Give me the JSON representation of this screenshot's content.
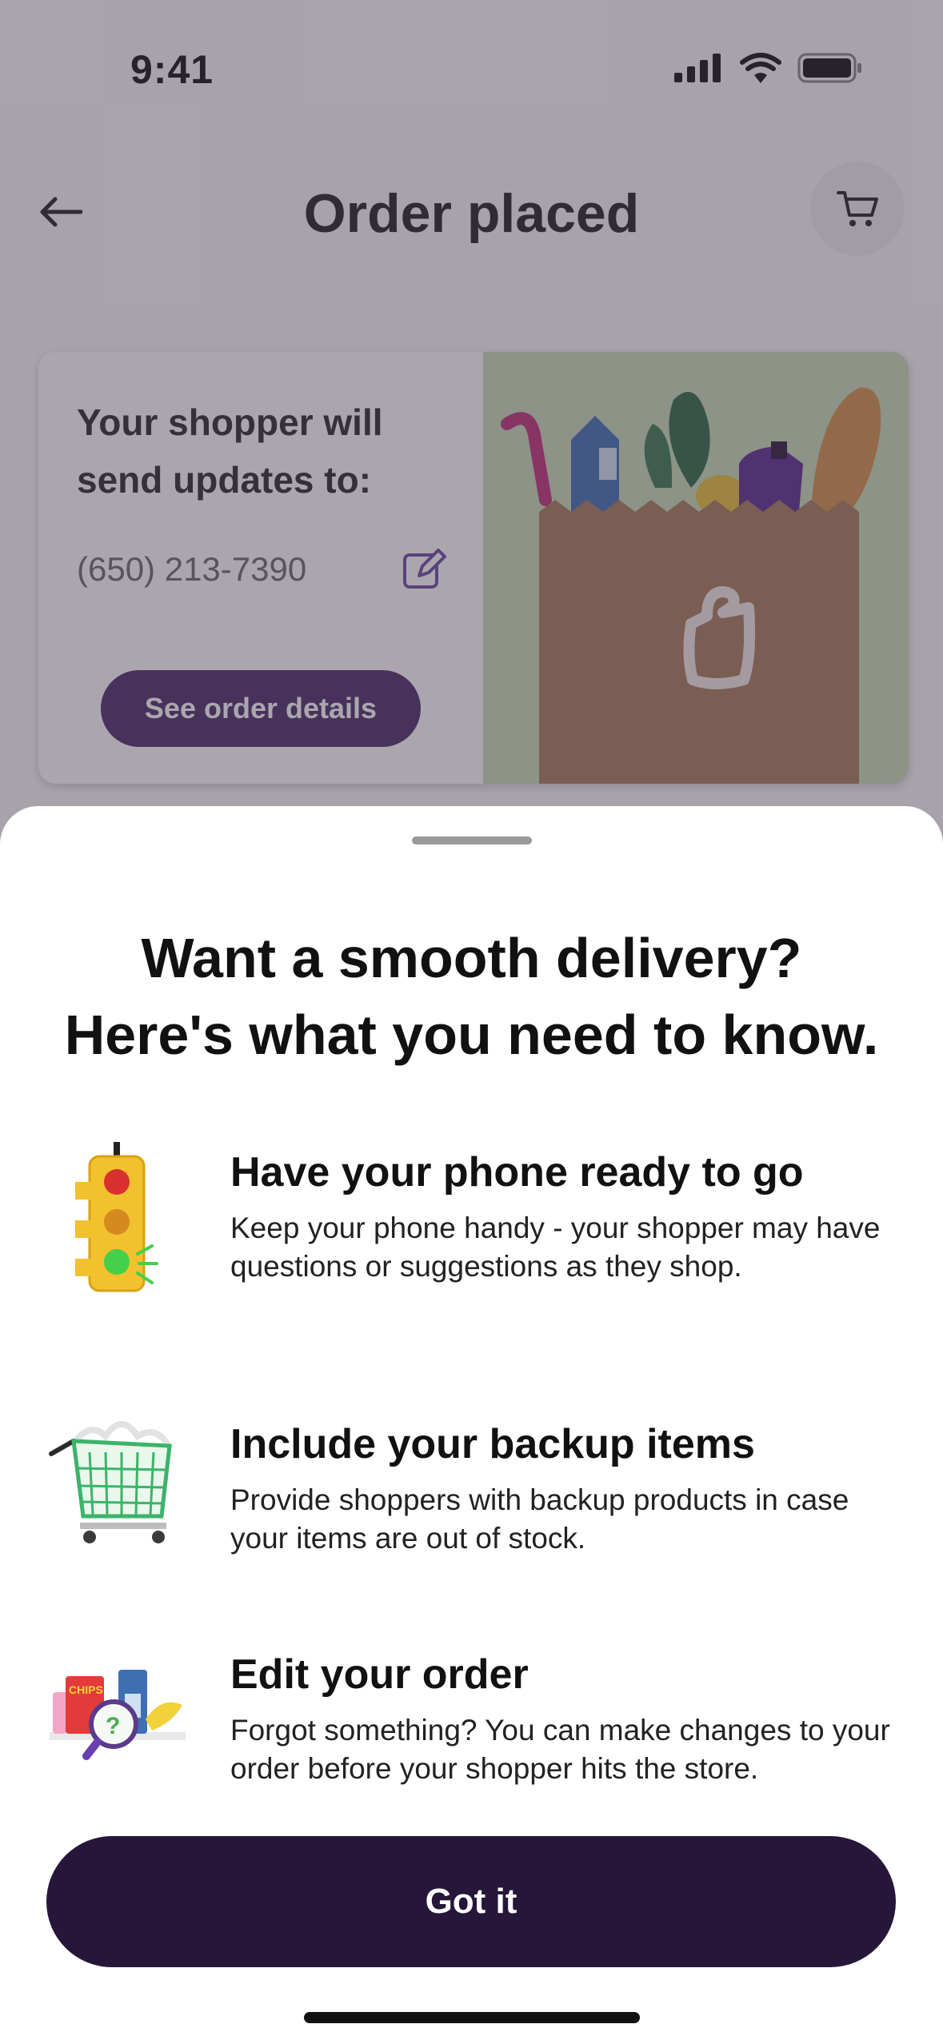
{
  "status_bar": {
    "time": "9:41",
    "icons": [
      "signal-icon",
      "wifi-icon",
      "battery-icon"
    ]
  },
  "header": {
    "title": "Order placed",
    "back_icon": "arrow-left-icon",
    "cart_icon": "cart-icon"
  },
  "card": {
    "heading": "Your shopper will send updates to:",
    "phone": "(650) 213-7390",
    "edit_icon": "edit-icon",
    "details_button": "See order details",
    "illustration": "grocery-bag-illustration"
  },
  "sheet": {
    "title_line1": "Want a smooth delivery?",
    "title_line2": "Here's what you need to know.",
    "tips": [
      {
        "icon": "traffic-light-icon",
        "title": "Have your phone ready to go",
        "description": "Keep your phone handy - your shopper may have questions or suggestions as they shop."
      },
      {
        "icon": "shopping-cart-icon",
        "title": "Include your backup items",
        "description": "Provide shoppers with backup products in case your items are out of stock."
      },
      {
        "icon": "edit-order-icon",
        "title": "Edit your order",
        "description": "Forgot something? You can make changes to your order before your shopper hits the store."
      }
    ],
    "button": "Got it"
  },
  "colors": {
    "primary": "#26163a",
    "secondary": "#4a2c6a",
    "overlay": "#443a4c"
  }
}
